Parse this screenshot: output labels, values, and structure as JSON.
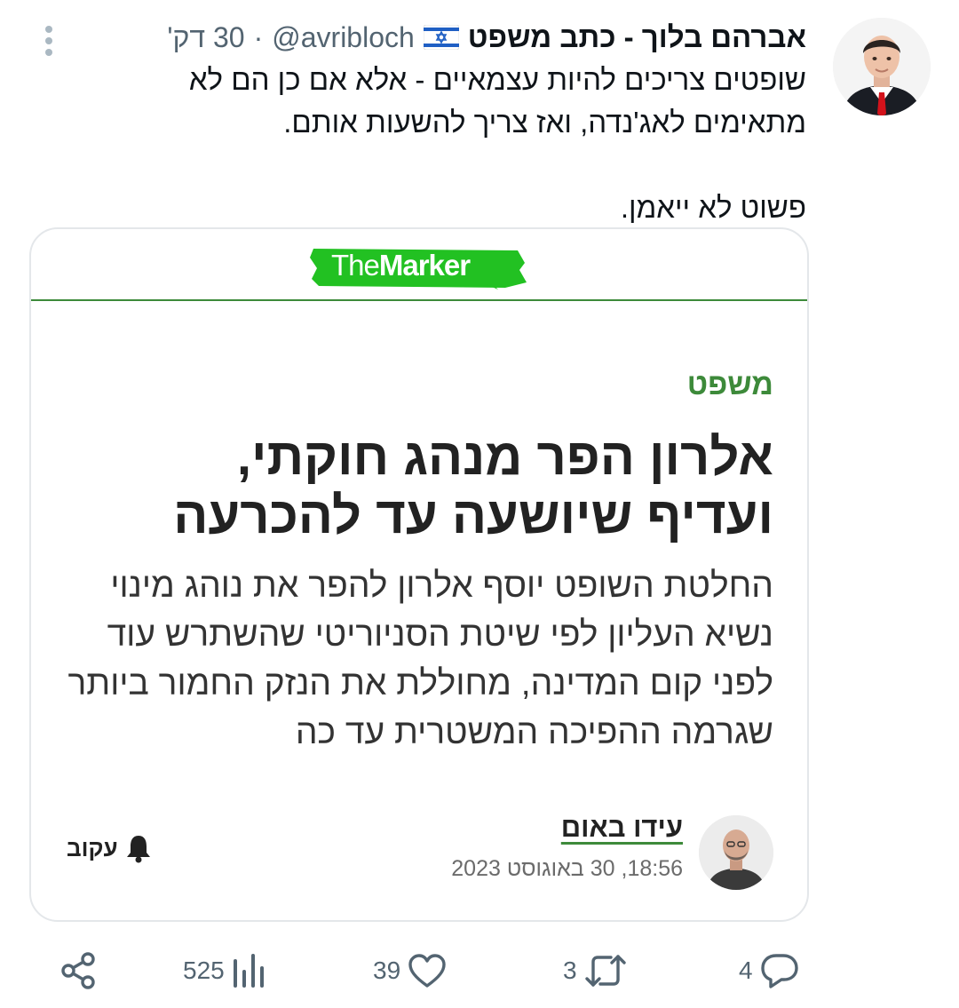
{
  "tweet": {
    "author_name": "אברהם בלוך - כתב משפט",
    "handle": "@avribloch",
    "separator": "·",
    "time": "30 דק'",
    "text_line1": "שופטים צריכים להיות עצמאיים - אלא אם כן הם לא מתאימים לאג'נדה, ואז צריך להשעות אותם.",
    "text_line2": "פשוט לא ייאמן."
  },
  "card": {
    "logo_the": "The",
    "logo_marker": "Marker",
    "brand_color": "#3d8a3a",
    "logo_green": "#22c122",
    "category": "משפט",
    "headline": "אלרון הפר מנהג חוקתי, ועדיף שיושעה עד להכרעה",
    "subhead": "החלטת השופט יוסף אלרון להפר את נוהג מינוי נשיא העליון לפי שיטת הסניוריטי שהשתרש עוד לפני קום המדינה, מחוללת את הנזק החמור ביותר שגרמה ההפיכה המשטרית עד כה",
    "writer_name": "עידו באום",
    "date": "18:56, 30 באוגוסט 2023",
    "follow_label": "עקוב"
  },
  "actions": {
    "replies": "4",
    "retweets": "3",
    "likes": "39",
    "views": "525"
  },
  "icons": {
    "flag": "israel-flag-icon",
    "more": "more-vertical-icon",
    "bell": "bell-icon",
    "reply": "reply-icon",
    "retweet": "retweet-icon",
    "like": "heart-icon",
    "views": "views-icon",
    "share": "share-icon"
  }
}
